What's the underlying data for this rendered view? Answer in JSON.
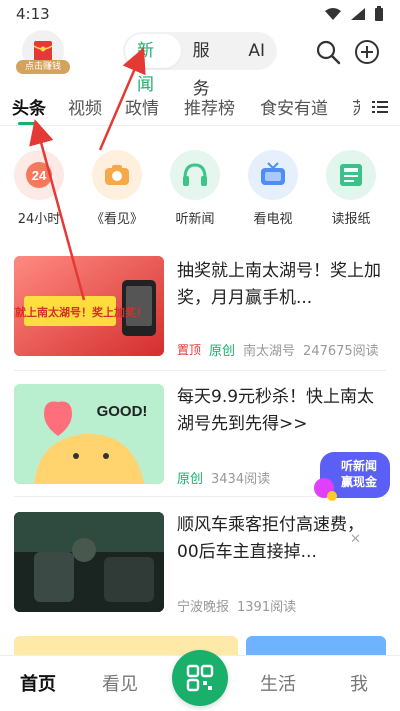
{
  "status": {
    "time": "4:13"
  },
  "avatar": {
    "badge": "点击赚钱"
  },
  "segments": [
    "新闻",
    "服务",
    "AI"
  ],
  "tabs": [
    "头条",
    "视频",
    "政情",
    "推荐榜",
    "食安有道",
    "苏"
  ],
  "quick": [
    {
      "label": "24小时",
      "icon": "clock-24-icon",
      "bg": "#fde9e6",
      "fg": "#f47a5b",
      "text": "24"
    },
    {
      "label": "《看见》",
      "icon": "camera-icon",
      "bg": "#fff0de",
      "fg": "#f7a84b"
    },
    {
      "label": "听新闻",
      "icon": "headphones-icon",
      "bg": "#e4f6ee",
      "fg": "#3cc489"
    },
    {
      "label": "看电视",
      "icon": "tv-icon",
      "bg": "#e6f0fd",
      "fg": "#4f8df6"
    },
    {
      "label": "读报纸",
      "icon": "newspaper-icon",
      "bg": "#e3f6ee",
      "fg": "#3ec08a"
    }
  ],
  "news": [
    {
      "title": "抽奖就上南太湖号！奖上加奖，月月赢手机...",
      "top": "置顶",
      "orig": "原创",
      "source": "南太湖号",
      "reads": "247675阅读",
      "thumb_text": "抽奖就上南太湖号！奖上加奖！"
    },
    {
      "title": "每天9.9元秒杀！快上南太湖号先到先得>>",
      "orig": "原创",
      "reads": "3434阅读",
      "thumb_text": "GOOD!"
    },
    {
      "title": "顺风车乘客拒付高速费，00后车主直接掉...",
      "source": "宁波晚报",
      "reads": "1391阅读"
    }
  ],
  "float_badge": {
    "line1": "听新闻",
    "line2": "赢现金"
  },
  "bottom_nav": [
    "首页",
    "看见",
    "生活",
    "我"
  ],
  "colors": {
    "accent": "#18b06b",
    "arrow": "#e53935"
  }
}
